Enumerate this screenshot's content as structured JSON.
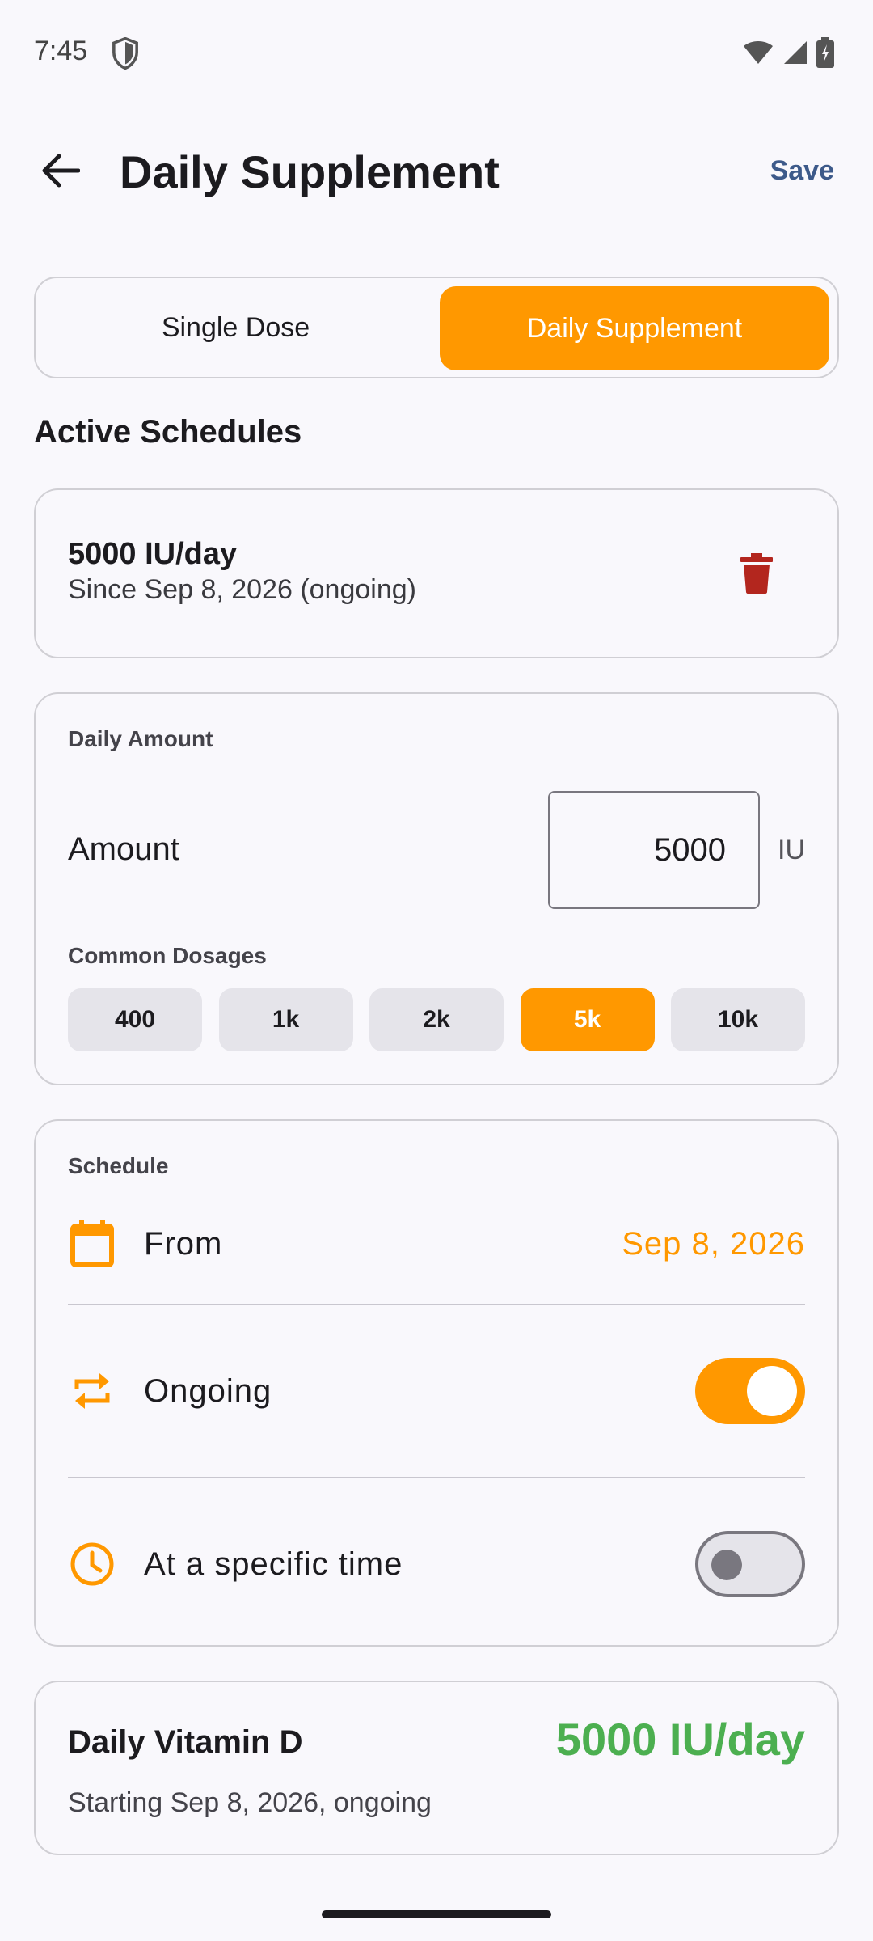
{
  "status_bar": {
    "time": "7:45"
  },
  "app_bar": {
    "title": "Daily Supplement",
    "save_label": "Save"
  },
  "mode_tabs": [
    {
      "label": "Single Dose",
      "selected": false
    },
    {
      "label": "Daily Supplement",
      "selected": true
    }
  ],
  "active_schedules": {
    "title": "Active Schedules",
    "items": [
      {
        "amount": "5000 IU/day",
        "since": "Since Sep 8, 2026 (ongoing)"
      }
    ]
  },
  "daily_amount": {
    "section_label": "Daily Amount",
    "amount_label": "Amount",
    "value": "5000",
    "unit": "IU",
    "common_label": "Common Dosages",
    "dosages": [
      {
        "label": "400",
        "selected": false
      },
      {
        "label": "1k",
        "selected": false
      },
      {
        "label": "2k",
        "selected": false
      },
      {
        "label": "5k",
        "selected": true
      },
      {
        "label": "10k",
        "selected": false
      }
    ]
  },
  "schedule": {
    "section_label": "Schedule",
    "from_label": "From",
    "from_value": "Sep 8, 2026",
    "ongoing_label": "Ongoing",
    "ongoing_on": true,
    "specific_time_label": "At a specific time",
    "specific_time_on": false
  },
  "summary": {
    "title": "Daily Vitamin D",
    "value": "5000 IU/day",
    "subtitle": "Starting Sep 8, 2026, ongoing"
  },
  "colors": {
    "accent": "#ff9800",
    "save": "#3d5a8a",
    "delete": "#b3261e",
    "summary_value": "#4caf50"
  }
}
